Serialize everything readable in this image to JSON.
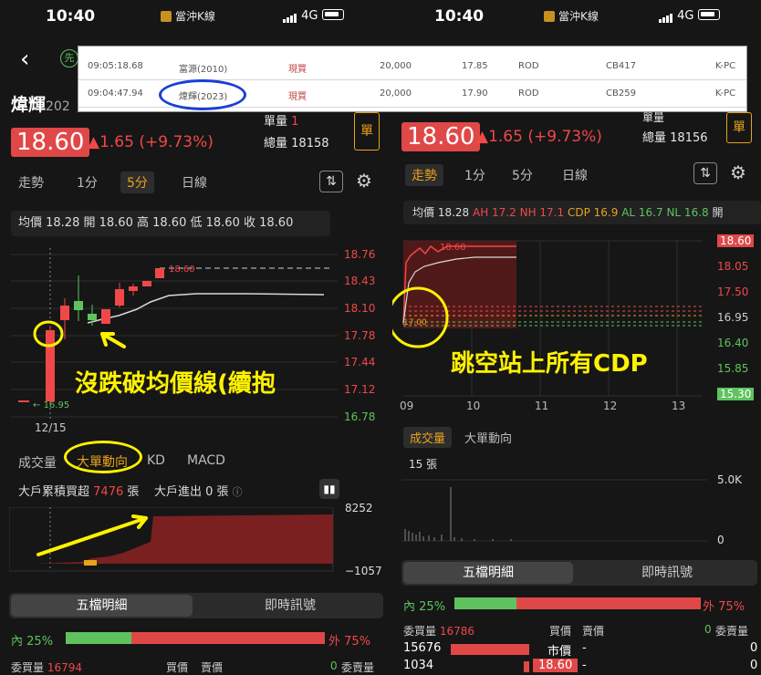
{
  "left": {
    "status": {
      "time": "10:40",
      "app": "當沖K線",
      "network": "4G"
    },
    "stock": {
      "name": "煒輝",
      "code_partial": "202",
      "price": "18.60",
      "change": "▲1.65",
      "change_pct": "(+9.73%)",
      "unit_label": "單量",
      "unit_value": "1",
      "volume_label": "總量",
      "volume_value": "18158",
      "order_button": "單"
    },
    "tabs": [
      "走勢",
      "1分",
      "5分",
      "日線"
    ],
    "active_tab": 2,
    "info_bar": {
      "avg": "均價 18.28",
      "open": "開 18.60",
      "high": "高 18.60",
      "low": "低 18.60",
      "close": "收 18.60"
    },
    "chart": {
      "y_ticks": [
        "18.76",
        "18.43",
        "18.10",
        "17.78",
        "17.44",
        "17.12",
        "16.78"
      ],
      "x_label": "12/15",
      "limit_up_label": "18.60",
      "start_label": "16.95",
      "annotation": "沒跌破均價線(續抱"
    },
    "sub_tabs": [
      "成交量",
      "大單動向",
      "KD",
      "MACD"
    ],
    "active_sub_tab": 1,
    "big_players": {
      "label1": "大戶累積買超",
      "value1": "7476",
      "unit1": "張",
      "label2": "大戶進出",
      "value2": "0",
      "unit2": "張"
    },
    "big_chart": {
      "max": "8252",
      "min": "−1057"
    },
    "segment": [
      "五檔明細",
      "即時訊號"
    ],
    "inner": {
      "label": "內",
      "pct": "25%"
    },
    "outer": {
      "label": "外",
      "pct": "75%"
    },
    "order_header": {
      "bid_qty_label": "委買量",
      "bid_qty": "16794",
      "buy_price": "買價",
      "sell_price": "賣價",
      "ask_qty": "0",
      "ask_qty_label": "委賣量"
    }
  },
  "right": {
    "status": {
      "time": "10:40",
      "app": "當沖K線",
      "network": "4G"
    },
    "stock": {
      "price": "18.60",
      "change": "▲1.65",
      "change_pct": "(+9.73%)",
      "unit_label": "單量",
      "volume_label": "總量",
      "volume_value": "18156",
      "order_button": "單"
    },
    "tabs": [
      "走勢",
      "1分",
      "5分",
      "日線"
    ],
    "active_tab": 0,
    "indicators": {
      "avg": "均價 18.28",
      "ah": "AH 17.2",
      "nh": "NH 17.1",
      "cdp": "CDP 16.9",
      "al": "AL 16.7",
      "nl": "NL 16.8",
      "more": "開"
    },
    "chart": {
      "y_ticks": [
        "18.60",
        "18.05",
        "17.50",
        "16.95",
        "16.40",
        "15.85",
        "15.30"
      ],
      "x_ticks": [
        "09",
        "10",
        "11",
        "12",
        "13"
      ],
      "peak_label": "18.60",
      "start_label": "17.00",
      "annotation": "跳空站上所有CDP"
    },
    "sub_tabs": [
      "成交量",
      "大單動向"
    ],
    "active_sub_tab": 0,
    "volume": {
      "label": "15 張",
      "max": "5.0K",
      "min": "0"
    },
    "segment": [
      "五檔明細",
      "即時訊號"
    ],
    "inner": {
      "label": "內",
      "pct": "25%"
    },
    "outer": {
      "label": "外",
      "pct": "75%"
    },
    "order_header": {
      "bid_qty_label": "委買量",
      "bid_qty": "16786",
      "buy_price": "買價",
      "sell_price": "賣價",
      "ask_qty": "0",
      "ask_qty_label": "委賣量"
    },
    "rows": [
      {
        "qty": "15676",
        "price": "市價",
        "sell": "-",
        "ask": "0"
      },
      {
        "qty": "1034",
        "price": "18.60",
        "sell": "-",
        "ask": "0"
      }
    ]
  },
  "trade_table": {
    "rows": [
      {
        "time": "09:05:18.68",
        "name": "富源(2010)",
        "side": "現買",
        "qty": "20,000",
        "price": "17.85",
        "type": "ROD",
        "acct": "CB417",
        "source": "K-PC"
      },
      {
        "time": "09:04:47.94",
        "name": "煒輝(2023)",
        "side": "現買",
        "qty": "20,000",
        "price": "17.90",
        "type": "ROD",
        "acct": "CB259",
        "source": "K-PC"
      }
    ]
  },
  "colors": {
    "up": "#f04848",
    "down": "#5ec35e",
    "accent": "#e8a21c",
    "annotation": "#fff200",
    "avg_line": "#d8d8d8"
  }
}
